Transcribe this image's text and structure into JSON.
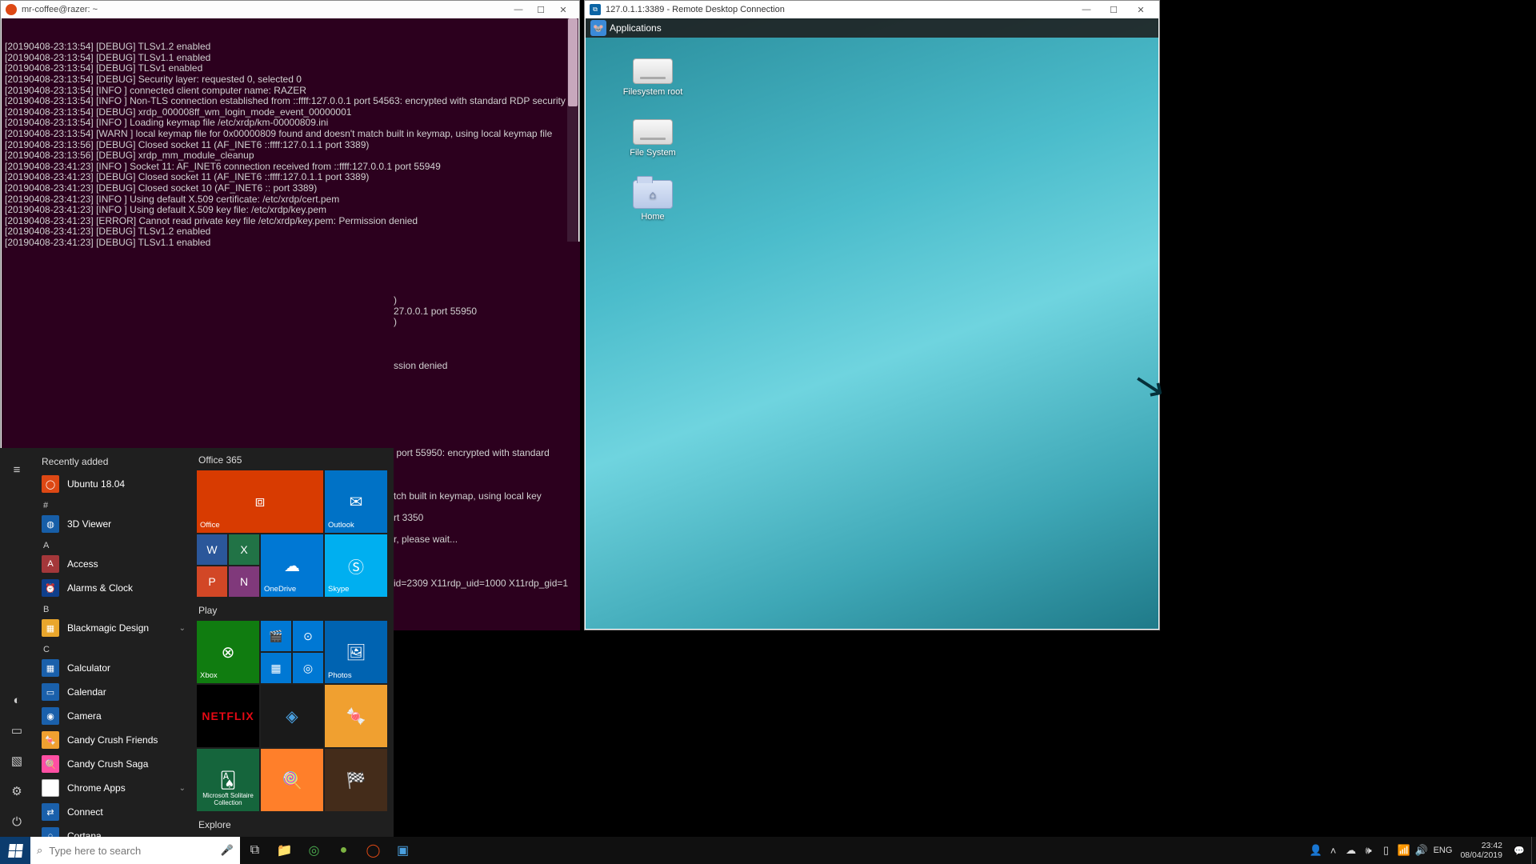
{
  "ubuntu_window": {
    "title": "mr-coffee@razer: ~",
    "log_lines": [
      "[20190408-23:13:54] [DEBUG] TLSv1.2 enabled",
      "[20190408-23:13:54] [DEBUG] TLSv1.1 enabled",
      "[20190408-23:13:54] [DEBUG] TLSv1 enabled",
      "[20190408-23:13:54] [DEBUG] Security layer: requested 0, selected 0",
      "[20190408-23:13:54] [INFO ] connected client computer name: RAZER",
      "[20190408-23:13:54] [INFO ] Non-TLS connection established from ::ffff:127.0.0.1 port 54563: encrypted with standard RDP security",
      "[20190408-23:13:54] [DEBUG] xrdp_000008ff_wm_login_mode_event_00000001",
      "[20190408-23:13:54] [INFO ] Loading keymap file /etc/xrdp/km-00000809.ini",
      "[20190408-23:13:54] [WARN ] local keymap file for 0x00000809 found and doesn't match built in keymap, using local keymap file",
      "[20190408-23:13:56] [DEBUG] Closed socket 11 (AF_INET6 ::ffff:127.0.1.1 port 3389)",
      "[20190408-23:13:56] [DEBUG] xrdp_mm_module_cleanup",
      "[20190408-23:41:23] [INFO ] Socket 11: AF_INET6 connection received from ::ffff:127.0.0.1 port 55949",
      "[20190408-23:41:23] [DEBUG] Closed socket 11 (AF_INET6 ::ffff:127.0.1.1 port 3389)",
      "[20190408-23:41:23] [DEBUG] Closed socket 10 (AF_INET6 :: port 3389)",
      "[20190408-23:41:23] [INFO ] Using default X.509 certificate: /etc/xrdp/cert.pem",
      "[20190408-23:41:23] [INFO ] Using default X.509 key file: /etc/xrdp/key.pem",
      "[20190408-23:41:23] [ERROR] Cannot read private key file /etc/xrdp/key.pem: Permission denied",
      "[20190408-23:41:23] [DEBUG] TLSv1.2 enabled",
      "[20190408-23:41:23] [DEBUG] TLSv1.1 enabled"
    ],
    "obscured_fragments": [
      ")",
      "27.0.0.1 port 55950",
      ")",
      "",
      "",
      "",
      "ssion denied",
      "",
      "",
      "",
      "",
      "",
      "",
      "",
      " port 55950: encrypted with standard",
      "",
      "",
      "",
      "tch built in keymap, using local key",
      "",
      "rt 3350",
      "",
      "r, please wait...",
      "",
      "",
      "",
      "id=2309 X11rdp_uid=1000 X11rdp_gid=1"
    ]
  },
  "rdp_window": {
    "title": "127.0.1.1:3389 - Remote Desktop Connection",
    "panel_label": "Applications",
    "icons": [
      {
        "label": "Filesystem root",
        "type": "drive"
      },
      {
        "label": "File System",
        "type": "drive"
      },
      {
        "label": "Home",
        "type": "folder"
      }
    ]
  },
  "start_menu": {
    "recently_added": "Recently added",
    "rail": {
      "expand": "≡",
      "user": "◐",
      "documents": "▭",
      "pictures": "▧",
      "settings": "⚙",
      "power": "⏻"
    },
    "apps": [
      {
        "letter": "",
        "items": [
          {
            "name": "Ubuntu 18.04",
            "cls": "bg-ub",
            "glyph": "◯"
          }
        ]
      },
      {
        "letter": "#",
        "items": [
          {
            "name": "3D Viewer",
            "cls": "bg-3d",
            "glyph": "◍"
          }
        ]
      },
      {
        "letter": "A",
        "items": [
          {
            "name": "Access",
            "cls": "bg-ac",
            "glyph": "A"
          },
          {
            "name": "Alarms & Clock",
            "cls": "bg-al",
            "glyph": "⏰"
          }
        ]
      },
      {
        "letter": "B",
        "items": [
          {
            "name": "Blackmagic Design",
            "cls": "bg-bm",
            "glyph": "▦",
            "expand": true
          }
        ]
      },
      {
        "letter": "C",
        "items": [
          {
            "name": "Calculator",
            "cls": "bg-cal",
            "glyph": "▦"
          },
          {
            "name": "Calendar",
            "cls": "bg-cld",
            "glyph": "▭"
          },
          {
            "name": "Camera",
            "cls": "bg-cam",
            "glyph": "◉"
          },
          {
            "name": "Candy Crush Friends",
            "cls": "bg-ccf",
            "glyph": "🍬"
          },
          {
            "name": "Candy Crush Saga",
            "cls": "bg-ccs",
            "glyph": "🍭"
          },
          {
            "name": "Chrome Apps",
            "cls": "bg-chr",
            "glyph": "◎",
            "expand": true
          },
          {
            "name": "Connect",
            "cls": "bg-con",
            "glyph": "⇄"
          },
          {
            "name": "Cortana",
            "cls": "bg-cor",
            "glyph": "○"
          }
        ]
      }
    ],
    "groups": [
      {
        "name": "Office 365"
      },
      {
        "name": "Play"
      },
      {
        "name": "Explore"
      }
    ],
    "tiles": {
      "office": "Office",
      "outlook": "Outlook",
      "onedrive": "OneDrive",
      "skype": "Skype",
      "xbox": "Xbox",
      "photos": "Photos",
      "solitaire": "Microsoft Solitaire Collection"
    }
  },
  "taskbar": {
    "search_placeholder": "Type here to search",
    "lang": "ENG",
    "time": "23:42",
    "date": "08/04/2019",
    "apps": [
      {
        "name": "task-view",
        "glyph": "⧉",
        "color": "#ddd"
      },
      {
        "name": "file-explorer",
        "glyph": "📁",
        "color": ""
      },
      {
        "name": "chrome",
        "glyph": "◎",
        "color": "#4caf50"
      },
      {
        "name": "app-green",
        "glyph": "●",
        "color": "#7cb342"
      },
      {
        "name": "ubuntu",
        "glyph": "◯",
        "color": "#dd4814"
      },
      {
        "name": "rdp",
        "glyph": "▣",
        "color": "#4aa0e0"
      }
    ],
    "tray": [
      {
        "name": "people-icon",
        "glyph": "👤"
      },
      {
        "name": "chevron-up-icon",
        "glyph": "˄"
      },
      {
        "name": "onedrive-icon",
        "glyph": "☁"
      },
      {
        "name": "bluetooth-icon",
        "glyph": "🕪"
      },
      {
        "name": "battery-icon",
        "glyph": "▯"
      },
      {
        "name": "wifi-icon",
        "glyph": "📶"
      },
      {
        "name": "volume-icon",
        "glyph": "🔊"
      }
    ]
  }
}
